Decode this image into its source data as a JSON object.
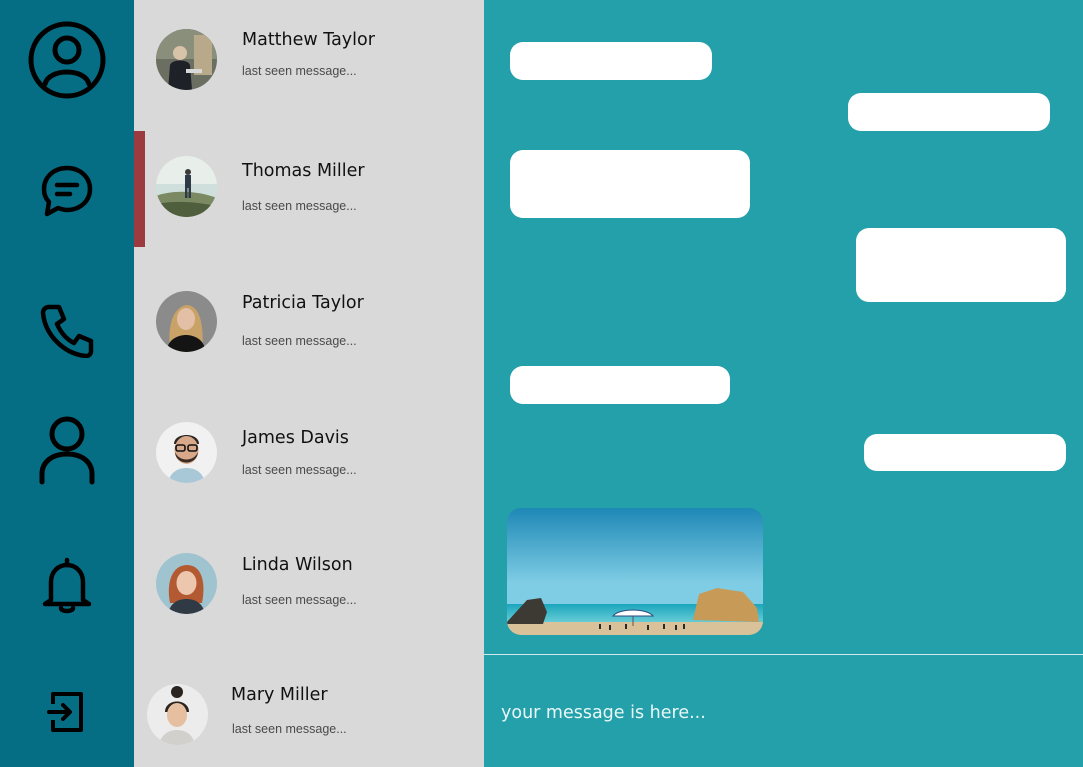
{
  "sidebar": {
    "icons": [
      "profile-circle-icon",
      "chat-bubble-icon",
      "phone-icon",
      "user-icon",
      "bell-icon",
      "logout-icon"
    ]
  },
  "contacts": [
    {
      "name": "Matthew Taylor",
      "subtitle": "last seen message..."
    },
    {
      "name": "Thomas Miller",
      "subtitle": "last seen message...",
      "active": true
    },
    {
      "name": "Patricia Taylor",
      "subtitle": "last seen message..."
    },
    {
      "name": "James Davis",
      "subtitle": "last seen message..."
    },
    {
      "name": "Linda Wilson",
      "subtitle": "last seen message..."
    },
    {
      "name": "Mary Miller",
      "subtitle": "last seen message..."
    }
  ],
  "composer": {
    "placeholder": "your message is here..."
  },
  "colors": {
    "rail": "#066e84",
    "contacts_bg": "#d9d9d9",
    "chat_bg": "#23a0a9",
    "active_indicator": "#9b3a3f",
    "bubble": "#ffffff"
  }
}
